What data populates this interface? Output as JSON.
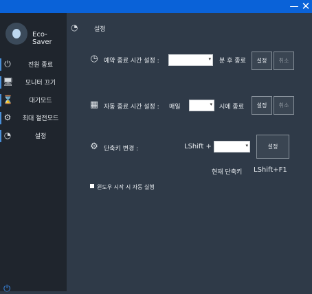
{
  "window": {
    "minimize_icon": "minimize-icon",
    "close_icon": "close-icon"
  },
  "brand": "Eco-Saver",
  "sidebar": {
    "items": [
      {
        "label": "전원 종료",
        "icon": "power-icon"
      },
      {
        "label": "모니터 끄기",
        "icon": "monitor-icon"
      },
      {
        "label": "대기모드",
        "icon": "hourglass-icon"
      },
      {
        "label": "최대 절전모드",
        "icon": "gear-sleep-icon"
      },
      {
        "label": "설정",
        "icon": "settings-icon"
      }
    ]
  },
  "page": {
    "title": "설정"
  },
  "reservation": {
    "label": "예약 종료 시간 설정 :",
    "unit": "분 후 종료",
    "set": "설정",
    "cancel": "취소"
  },
  "auto": {
    "label": "자동 종료 시간 설정 :",
    "daily": "매일",
    "unit": "시에 종료",
    "set": "설정",
    "cancel": "취소"
  },
  "hotkey": {
    "label": "단축키 변경 :",
    "prefix": "LShift +",
    "set": "설정",
    "current_label": "현재 단축키",
    "current_value": "LShift+F1"
  },
  "startup": {
    "label": "윈도우 시작 시 자동 실행"
  }
}
